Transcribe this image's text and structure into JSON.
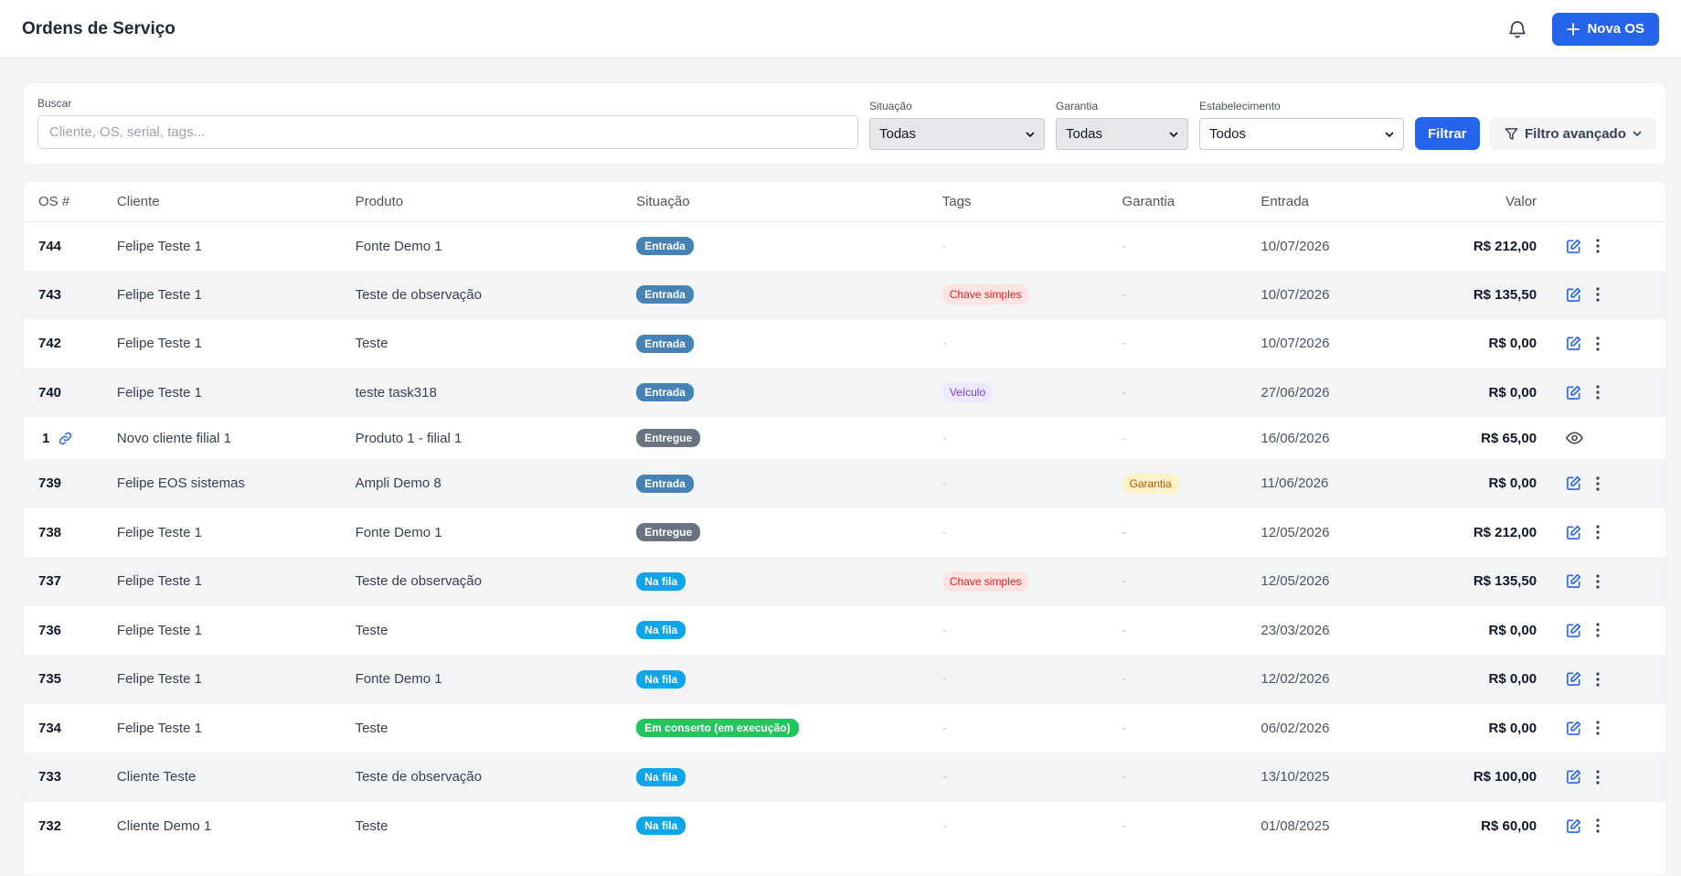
{
  "header": {
    "title": "Ordens de Serviço",
    "new_button": "Nova OS"
  },
  "filters": {
    "search_label": "Buscar",
    "search_placeholder": "Cliente, OS, serial, tags...",
    "situacao_label": "Situação",
    "situacao_value": "Todas",
    "garantia_label": "Garantia",
    "garantia_value": "Todas",
    "estab_label": "Estabelecimento",
    "estab_value": "Todos",
    "filter_button": "Filtrar",
    "advanced_button": "Filtro avançado"
  },
  "table": {
    "columns": [
      "OS #",
      "Cliente",
      "Produto",
      "Situação",
      "Tags",
      "Garantia",
      "Entrada",
      "Valor"
    ],
    "rows": [
      {
        "os": "744",
        "cliente": "Felipe Teste 1",
        "produto": "Fonte Demo 1",
        "situacao": "Entrada",
        "tags": "-",
        "garantia": "-",
        "entrada": "10/07/2026",
        "valor": "R$ 212,00"
      },
      {
        "os": "743",
        "cliente": "Felipe Teste 1",
        "produto": "Teste de observação",
        "situacao": "Entrada",
        "tags": "Chave simples",
        "garantia": "-",
        "entrada": "10/07/2026",
        "valor": "R$ 135,50"
      },
      {
        "os": "742",
        "cliente": "Felipe Teste 1",
        "produto": "Teste",
        "situacao": "Entrada",
        "tags": "-",
        "garantia": "-",
        "entrada": "10/07/2026",
        "valor": "R$ 0,00"
      },
      {
        "os": "740",
        "cliente": "Felipe Teste 1",
        "produto": "teste task318",
        "situacao": "Entrada",
        "tags": "Veículo",
        "garantia": "-",
        "entrada": "27/06/2026",
        "valor": "R$ 0,00"
      },
      {
        "os": "1",
        "cliente": "Novo cliente filial 1",
        "produto": "Produto 1 - filial 1",
        "situacao": "Entregue",
        "tags": "-",
        "garantia": "-",
        "entrada": "16/06/2026",
        "valor": "R$ 65,00"
      },
      {
        "os": "739",
        "cliente": "Felipe EOS sistemas",
        "produto": "Ampli Demo 8",
        "situacao": "Entrada",
        "tags": "-",
        "garantia": "Garantia",
        "entrada": "11/06/2026",
        "valor": "R$ 0,00"
      },
      {
        "os": "738",
        "cliente": "Felipe Teste 1",
        "produto": "Fonte Demo 1",
        "situacao": "Entregue",
        "tags": "-",
        "garantia": "-",
        "entrada": "12/05/2026",
        "valor": "R$ 212,00"
      },
      {
        "os": "737",
        "cliente": "Felipe Teste 1",
        "produto": "Teste de observação",
        "situacao": "Na fila",
        "tags": "Chave simples",
        "garantia": "-",
        "entrada": "12/05/2026",
        "valor": "R$ 135,50"
      },
      {
        "os": "736",
        "cliente": "Felipe Teste 1",
        "produto": "Teste",
        "situacao": "Na fila",
        "tags": "-",
        "garantia": "-",
        "entrada": "23/03/2026",
        "valor": "R$ 0,00"
      },
      {
        "os": "735",
        "cliente": "Felipe Teste 1",
        "produto": "Fonte Demo 1",
        "situacao": "Na fila",
        "tags": "-",
        "garantia": "-",
        "entrada": "12/02/2026",
        "valor": "R$ 0,00"
      },
      {
        "os": "734",
        "cliente": "Felipe Teste 1",
        "produto": "Teste",
        "situacao": "Em conserto (em execução)",
        "tags": "-",
        "garantia": "-",
        "entrada": "06/02/2026",
        "valor": "R$ 0,00"
      },
      {
        "os": "733",
        "cliente": "Cliente Teste",
        "produto": "Teste de observação",
        "situacao": "Na fila",
        "tags": "-",
        "garantia": "-",
        "entrada": "13/10/2025",
        "valor": "R$ 100,00"
      },
      {
        "os": "732",
        "cliente": "Cliente Demo 1",
        "produto": "Teste",
        "situacao": "Na fila",
        "tags": "-",
        "garantia": "-",
        "entrada": "01/08/2025",
        "valor": "R$ 60,00"
      }
    ]
  },
  "colors": {
    "primary": "#2563eb",
    "entrada": "#4682b4",
    "entregue": "#6b7280",
    "na_fila": "#0ea5e9",
    "em_conserto": "#22c55e"
  },
  "icons": {
    "bell": "bell-icon",
    "plus": "plus-icon",
    "funnel": "funnel-icon",
    "edit": "edit-icon",
    "more": "kebab-icon",
    "view": "eye-icon",
    "link": "link-icon"
  }
}
